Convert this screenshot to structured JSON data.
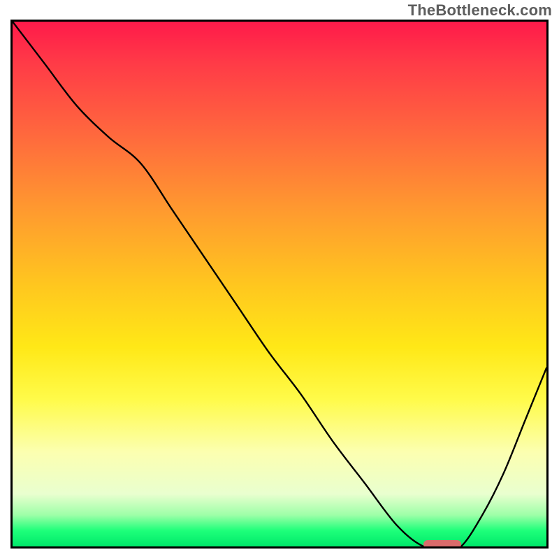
{
  "watermark": "TheBottleneck.com",
  "gradient": {
    "top": "#ff1a4a",
    "mid_upper": "#ff9a2f",
    "mid": "#ffe817",
    "mid_lower": "#fcffb0",
    "bottom": "#00e86a"
  },
  "chart_data": {
    "type": "line",
    "title": "",
    "xlabel": "",
    "ylabel": "",
    "xlim": [
      0,
      100
    ],
    "ylim": [
      0,
      100
    ],
    "grid": false,
    "series": [
      {
        "name": "bottleneck-curve",
        "x": [
          0,
          6,
          12,
          18,
          24,
          30,
          36,
          42,
          48,
          54,
          60,
          66,
          72,
          77,
          81,
          84,
          88,
          92,
          96,
          100
        ],
        "values": [
          100,
          92,
          84,
          78,
          73,
          64,
          55,
          46,
          37,
          29,
          20,
          12,
          4,
          0,
          0,
          0,
          6,
          14,
          24,
          34
        ]
      }
    ],
    "optimal_marker": {
      "x_start": 77,
      "x_end": 84,
      "y": 0
    }
  }
}
